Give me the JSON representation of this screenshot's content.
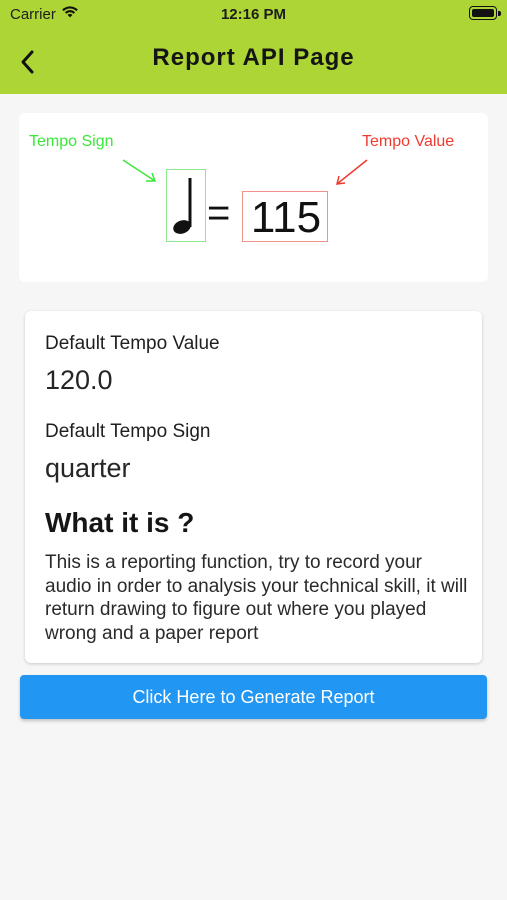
{
  "status_bar": {
    "carrier": "Carrier",
    "time": "12:16 PM",
    "icons": [
      "wifi-icon",
      "battery-icon"
    ]
  },
  "app_bar": {
    "title": "Report API Page",
    "back_icon": "chevron-left-icon",
    "background_color": "#add536"
  },
  "legend": {
    "sign_label": "Tempo Sign",
    "value_label": "Tempo Value",
    "sign_label_color": "#3ae83a",
    "value_label_color": "#ee3b30",
    "note_icon": "quarter-note-icon",
    "equals": "=",
    "tempo_value": "115"
  },
  "info": {
    "default_value_label": "Default Tempo Value",
    "default_value": "120.0",
    "default_sign_label": "Default Tempo Sign",
    "default_sign": "quarter",
    "what_heading": "What it is ?",
    "description": "This is a reporting function, try to record your audio in order to analysis your technical skill, it will return drawing to figure out where you played wrong and a paper report"
  },
  "actions": {
    "generate_label": "Click Here to Generate Report",
    "button_color": "#2196f3"
  }
}
